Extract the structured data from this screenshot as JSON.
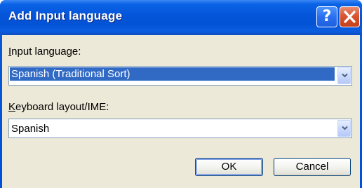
{
  "window": {
    "title": "Add Input language"
  },
  "titlebar": {
    "help_glyph": "?",
    "close_icon": "close-icon"
  },
  "input_language": {
    "label_mnemonic": "I",
    "label_rest": "nput language:",
    "value": "Spanish (Traditional Sort)"
  },
  "keyboard_layout": {
    "label_mnemonic": "K",
    "label_rest": "eyboard layout/IME:",
    "value": "Spanish"
  },
  "buttons": {
    "ok": "OK",
    "cancel": "Cancel"
  },
  "colors": {
    "titlebar": "#0554d9",
    "client_bg": "#ece9d8",
    "selection": "#316ac5",
    "close_button": "#d8552f"
  }
}
